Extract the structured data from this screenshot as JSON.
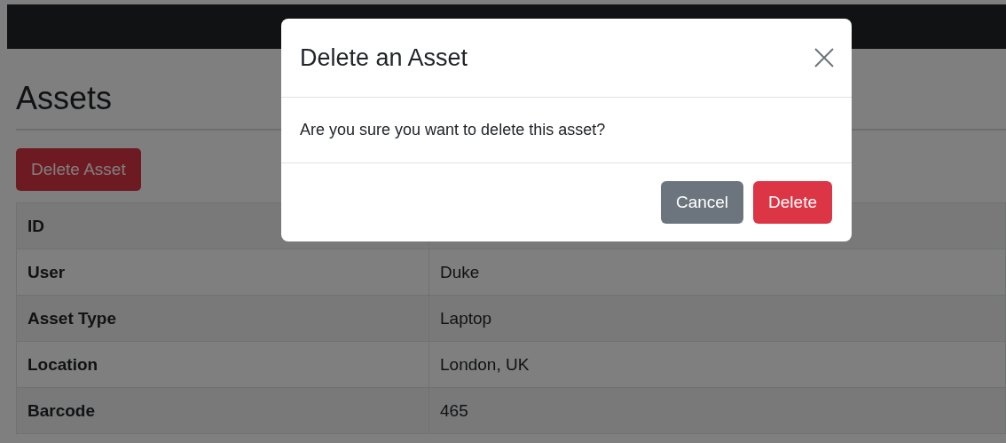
{
  "page": {
    "title": "Assets",
    "delete_button": "Delete Asset"
  },
  "table": {
    "rows": [
      {
        "label": "ID"
      },
      {
        "label": "User",
        "value": "Duke"
      },
      {
        "label": "Asset Type",
        "value": "Laptop"
      },
      {
        "label": "Location",
        "value": "London, UK"
      },
      {
        "label": "Barcode",
        "value": "465"
      }
    ]
  },
  "modal": {
    "title": "Delete an Asset",
    "message": "Are you sure you want to delete this asset?",
    "buttons": [
      {
        "label": "Cancel",
        "kind": "secondary"
      },
      {
        "label": "Delete",
        "kind": "danger"
      }
    ]
  }
}
